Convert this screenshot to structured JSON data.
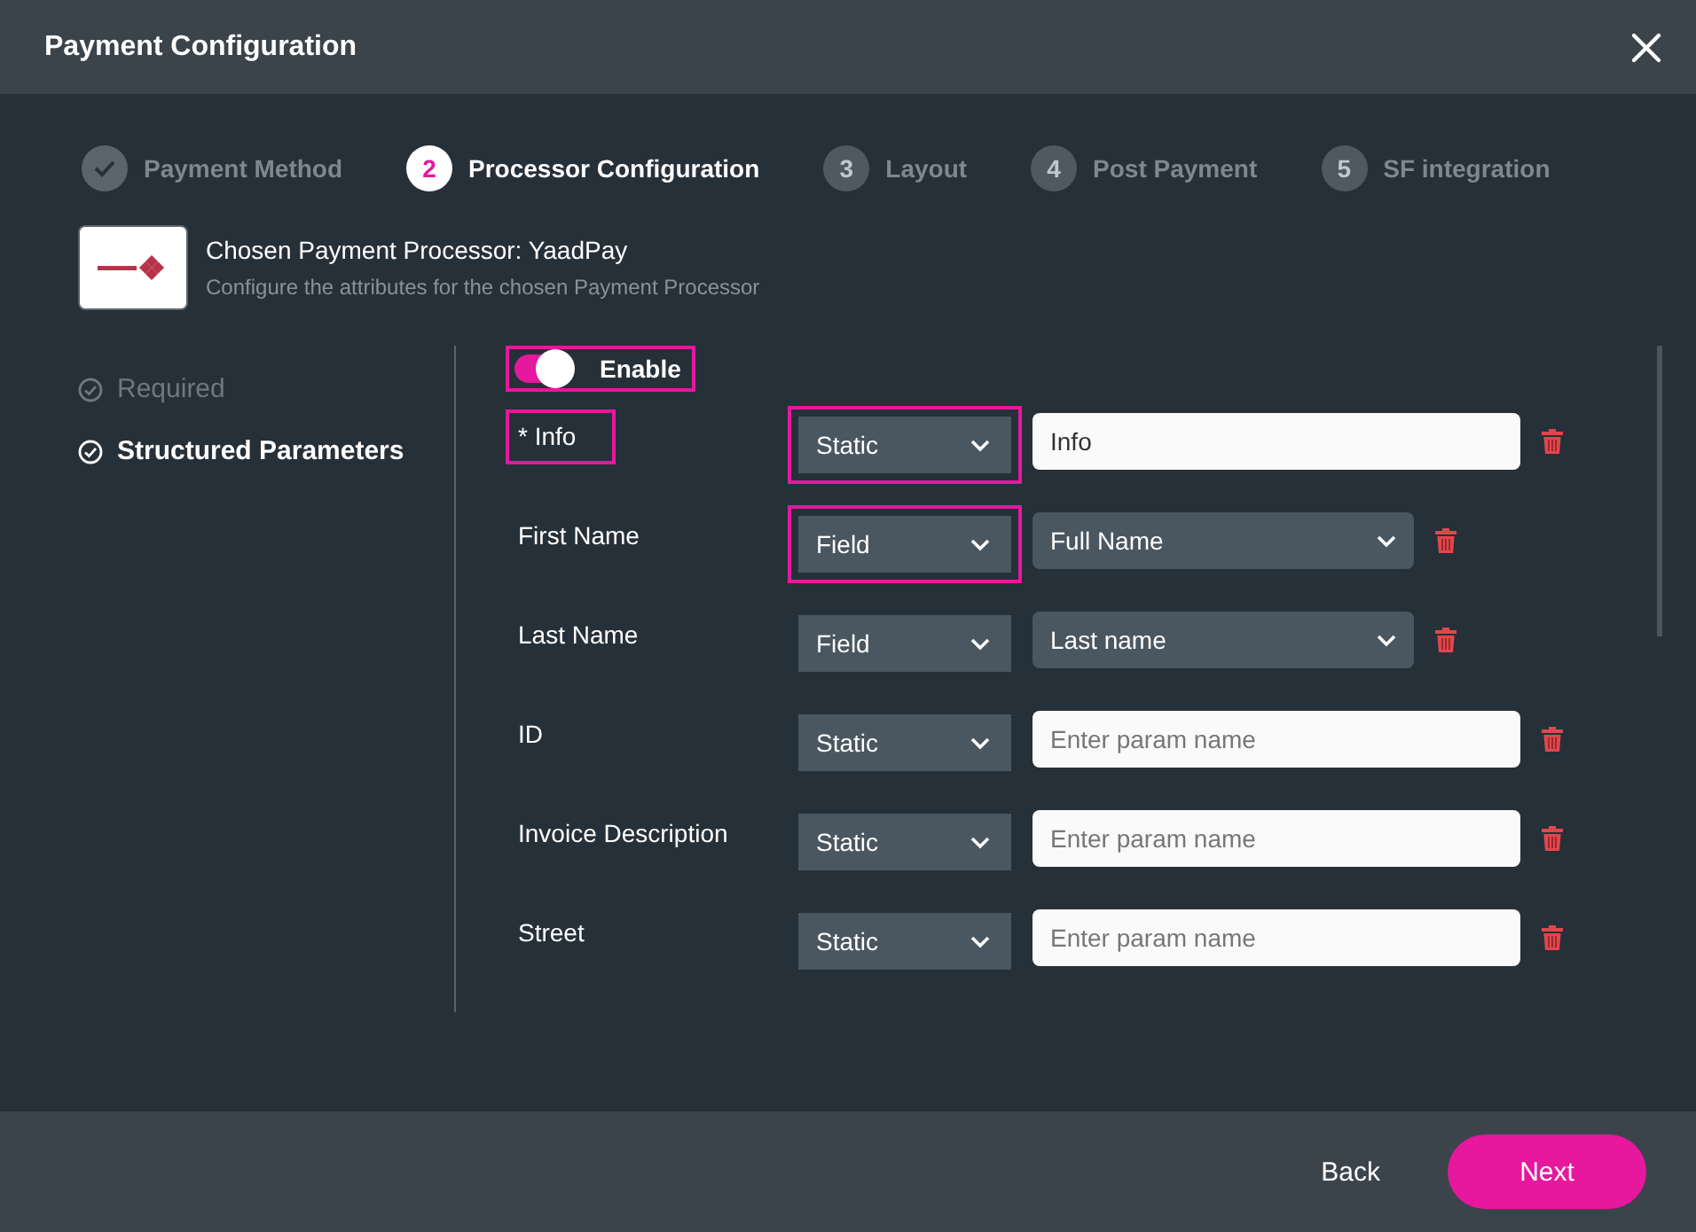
{
  "window": {
    "title": "Payment Configuration"
  },
  "steps": [
    {
      "label": "Payment Method",
      "completed": true,
      "selected": false
    },
    {
      "number": "2",
      "label": "Processor Configuration",
      "completed": false,
      "selected": true
    },
    {
      "number": "3",
      "label": "Layout",
      "completed": false,
      "selected": false
    },
    {
      "number": "4",
      "label": "Post Payment",
      "completed": false,
      "selected": false
    },
    {
      "number": "5",
      "label": "SF integration",
      "completed": false,
      "selected": false
    }
  ],
  "processor": {
    "title": "Chosen Payment Processor: YaadPay",
    "subtitle": "Configure the attributes for the chosen Payment Processor"
  },
  "sidebar": {
    "items": [
      {
        "label": "Required",
        "selected": false
      },
      {
        "label": "Structured Parameters",
        "selected": true
      }
    ]
  },
  "enable": {
    "label": "Enable",
    "on": true,
    "highlighted": true
  },
  "params": [
    {
      "label": "* Info",
      "label_highlighted": true,
      "mode": "Static",
      "mode_highlighted": true,
      "kind": "input",
      "value": "Info"
    },
    {
      "label": "First Name",
      "label_highlighted": false,
      "mode": "Field",
      "mode_highlighted": true,
      "kind": "select",
      "value": "Full Name"
    },
    {
      "label": "Last Name",
      "label_highlighted": false,
      "mode": "Field",
      "mode_highlighted": false,
      "kind": "select",
      "value": "Last name"
    },
    {
      "label": "ID",
      "label_highlighted": false,
      "mode": "Static",
      "mode_highlighted": false,
      "kind": "input",
      "placeholder": "Enter param name"
    },
    {
      "label": "Invoice Description",
      "label_highlighted": false,
      "mode": "Static",
      "mode_highlighted": false,
      "kind": "input",
      "placeholder": "Enter param name"
    },
    {
      "label": "Street",
      "label_highlighted": false,
      "mode": "Static",
      "mode_highlighted": false,
      "kind": "input",
      "placeholder": "Enter param name"
    }
  ],
  "buttons": [
    {
      "label": "Back",
      "kind": "text"
    },
    {
      "label": "Next",
      "kind": "primary"
    }
  ]
}
